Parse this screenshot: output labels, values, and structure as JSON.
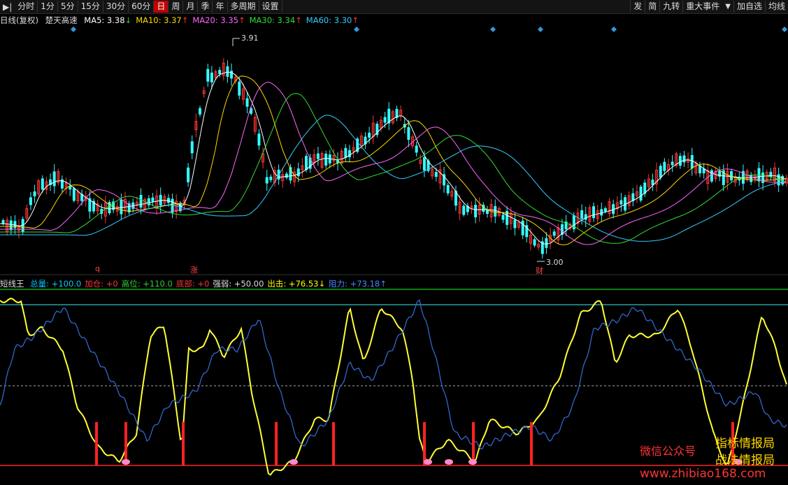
{
  "toolbar": {
    "nav_icon": "▶|",
    "left_items": [
      {
        "label": "分时",
        "active": false
      },
      {
        "label": "1分",
        "active": false
      },
      {
        "label": "5分",
        "active": false
      },
      {
        "label": "15分",
        "active": false
      },
      {
        "label": "30分",
        "active": false
      },
      {
        "label": "60分",
        "active": false
      },
      {
        "label": "日",
        "active": true
      },
      {
        "label": "周",
        "active": false
      },
      {
        "label": "月",
        "active": false
      },
      {
        "label": "季",
        "active": false
      },
      {
        "label": "年",
        "active": false
      },
      {
        "label": "多周期",
        "active": false
      },
      {
        "label": "设置",
        "active": false
      }
    ],
    "right_items": [
      "发",
      "简",
      "九转",
      "重大事件",
      "加自选",
      "均线"
    ],
    "right_dropdown_icon": "▼"
  },
  "ma_row": {
    "period": "日线(复权)",
    "indicator": "楚天高速",
    "items": [
      {
        "label": "MA5: 3.38",
        "arrow": "↓",
        "color": "#ffffff"
      },
      {
        "label": "MA10: 3.37",
        "arrow": "↑",
        "color": "#ffd700"
      },
      {
        "label": "MA20: 3.35",
        "arrow": "↑",
        "color": "#ff66ff"
      },
      {
        "label": "MA30: 3.34",
        "arrow": "↑",
        "color": "#33dd33"
      },
      {
        "label": "MA60: 3.30",
        "arrow": "↑",
        "color": "#33ccff"
      }
    ]
  },
  "price_chart": {
    "high_label": "3.91",
    "low_label": "3.00",
    "marker_q": "q",
    "marker_zhang": "涨",
    "marker_cai": "财",
    "colors": {
      "up": "#ff3333",
      "down": "#33ffff",
      "ma5": "#ffffff",
      "ma10": "#ffd700",
      "ma20": "#ff66ff",
      "ma30": "#33dd33",
      "ma60": "#33ccff"
    }
  },
  "indicator_row": {
    "name": "短线王",
    "items": [
      {
        "label": "总量: +100.0",
        "color": "#00ccff"
      },
      {
        "label": "加仓: +0",
        "color": "#ff3333"
      },
      {
        "label": "高位: +110.0",
        "color": "#33cc33"
      },
      {
        "label": "底部: +0",
        "color": "#ff3333"
      },
      {
        "label": "强弱: +50.00",
        "color": "#dddddd"
      },
      {
        "label": "出击: +76.53↓",
        "color": "#ffff00"
      },
      {
        "label": "阻力: +73.18↑",
        "color": "#4488ff"
      }
    ]
  },
  "watermark": {
    "wechat": "微信公众号",
    "line1": "指标情报局",
    "line2": "战法情报局",
    "url": "www.zhibiao168.com"
  }
}
